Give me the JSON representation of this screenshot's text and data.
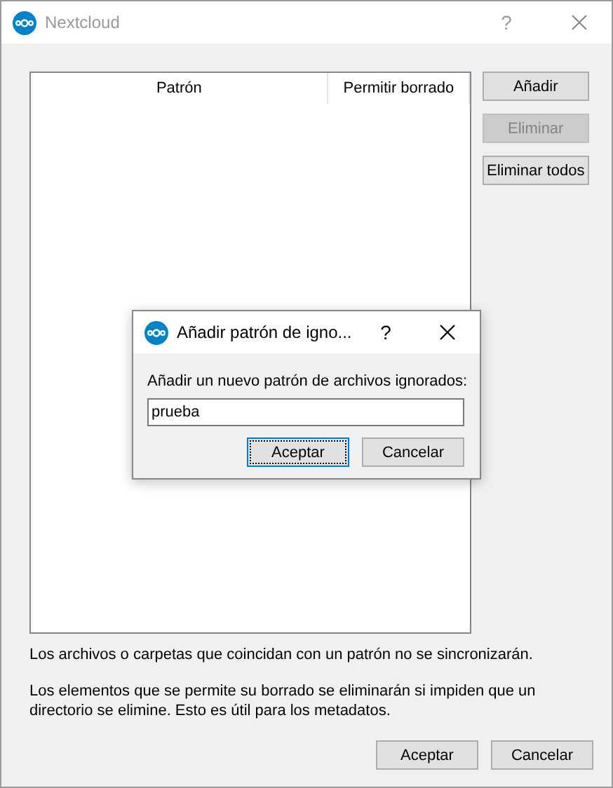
{
  "window": {
    "title": "Nextcloud",
    "help": "?"
  },
  "table": {
    "columns": [
      "Patrón",
      "Permitir borrado"
    ]
  },
  "side_buttons": [
    {
      "label": "Añadir",
      "disabled": false
    },
    {
      "label": "Eliminar",
      "disabled": true
    },
    {
      "label": "Eliminar todos",
      "disabled": false
    }
  ],
  "notes": [
    "Los archivos o carpetas que coincidan con un patrón no se sincronizarán.",
    "Los elementos que se permite su borrado se eliminarán si impiden que un directorio se elimine. Esto es útil para los metadatos."
  ],
  "buttons": [
    {
      "label": "Aceptar",
      "focused": false
    },
    {
      "label": "Cancelar",
      "focused": false
    }
  ],
  "dialog": {
    "title": "Añadir patrón de igno...",
    "help": "?",
    "label": "Añadir un nuevo patrón de archivos ignorados:",
    "value": "prueba",
    "buttons": [
      {
        "label": "Aceptar",
        "focused": true
      },
      {
        "label": "Cancelar",
        "focused": false
      }
    ]
  }
}
